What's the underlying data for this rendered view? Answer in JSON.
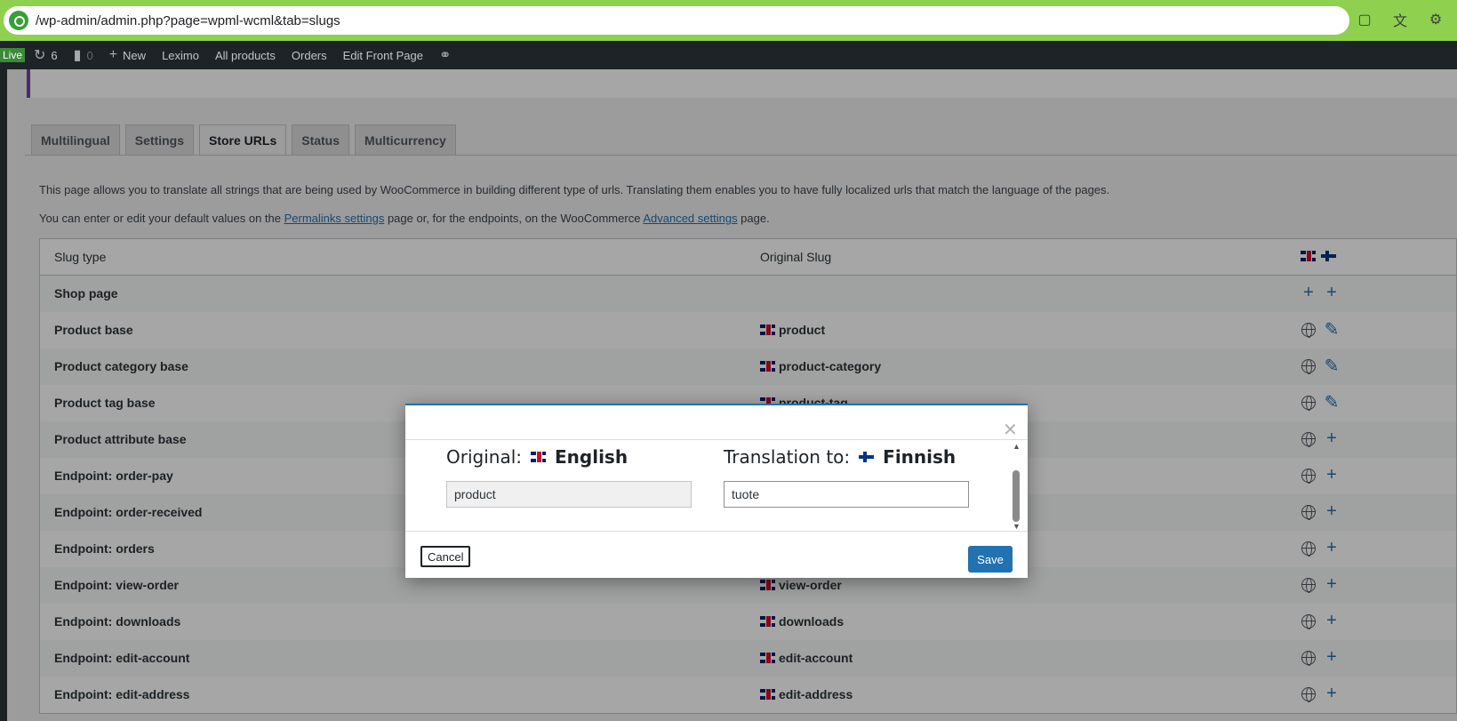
{
  "browser": {
    "url": "/wp-admin/admin.php?page=wpml-wcml&tab=slugs"
  },
  "adminbar": {
    "live": "Live",
    "updates_count": "6",
    "comments_count": "0",
    "new_label": "New",
    "site_name": "Leximo",
    "all_products": "All products",
    "orders": "Orders",
    "edit_front_page": "Edit Front Page"
  },
  "tabs": [
    "Multilingual",
    "Settings",
    "Store URLs",
    "Status",
    "Multicurrency"
  ],
  "intro": {
    "line1": "This page allows you to translate all strings that are being used by WooCommerce in building different type of urls. Translating them enables you to have fully localized urls that match the language of the pages.",
    "line2_a": "You can enter or edit your default values on the ",
    "line2_link1": "Permalinks settings",
    "line2_b": " page or, for the endpoints, on the WooCommerce ",
    "line2_link2": "Advanced settings",
    "line2_c": " page."
  },
  "table": {
    "col_slug_type": "Slug type",
    "col_original_slug": "Original Slug",
    "rows": [
      {
        "type": "Shop page",
        "original": "",
        "action": "plus"
      },
      {
        "type": "Product base",
        "original": "product",
        "action": "edit"
      },
      {
        "type": "Product category base",
        "original": "product-category",
        "action": "edit"
      },
      {
        "type": "Product tag base",
        "original": "product-tag",
        "action": "edit"
      },
      {
        "type": "Product attribute base",
        "original": "",
        "action": "plus"
      },
      {
        "type": "Endpoint: order-pay",
        "original": "",
        "action": "plus"
      },
      {
        "type": "Endpoint: order-received",
        "original": "",
        "action": "plus"
      },
      {
        "type": "Endpoint: orders",
        "original": "",
        "action": "plus"
      },
      {
        "type": "Endpoint: view-order",
        "original": "view-order",
        "action": "plus"
      },
      {
        "type": "Endpoint: downloads",
        "original": "downloads",
        "action": "plus"
      },
      {
        "type": "Endpoint: edit-account",
        "original": "edit-account",
        "action": "plus"
      },
      {
        "type": "Endpoint: edit-address",
        "original": "edit-address",
        "action": "plus"
      }
    ]
  },
  "dialog": {
    "original_label": "Original:",
    "original_lang": "English",
    "translation_label": "Translation to:",
    "translation_lang": "Finnish",
    "original_value": "product",
    "translation_value": "tuote",
    "cancel": "Cancel",
    "save": "Save"
  },
  "colors": {
    "accent": "#2271b1",
    "browser_bar": "#8fd14f",
    "adminbar": "#1d2327"
  }
}
